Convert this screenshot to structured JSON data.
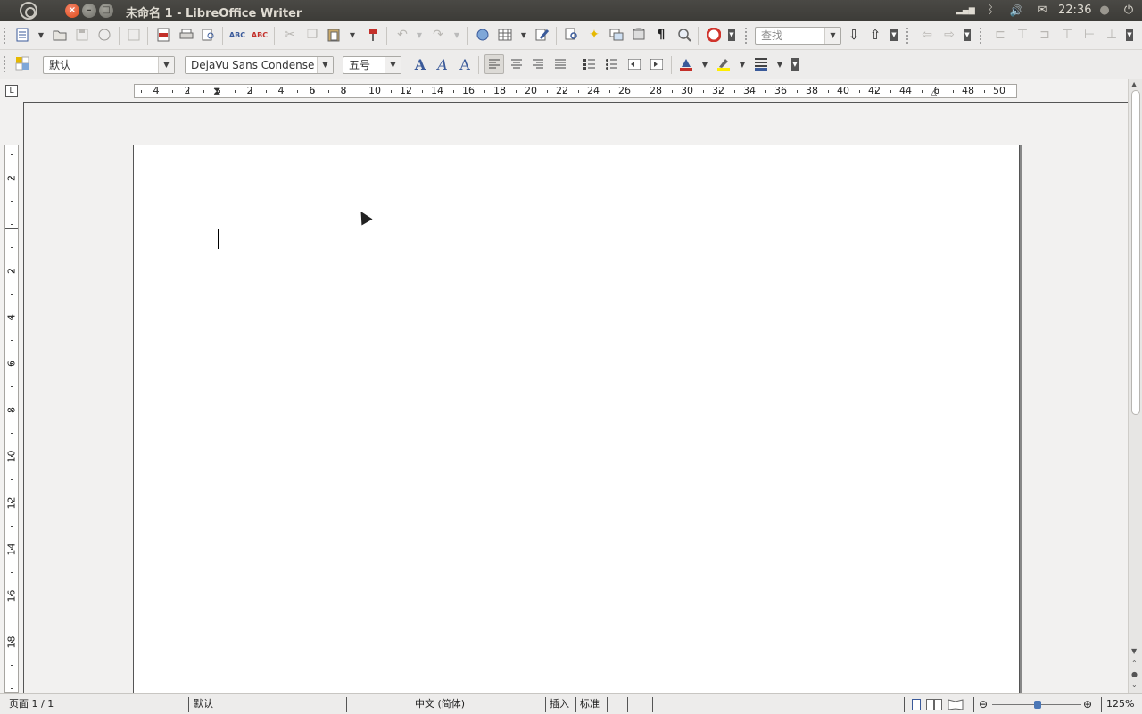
{
  "window": {
    "title": "未命名 1 - LibreOffice Writer",
    "close_label": "×",
    "min_label": "–",
    "max_label": "□"
  },
  "tray": {
    "signal_icon": "▂▄▆",
    "bluetooth_icon": "ᛒ",
    "volume_icon": "🔊",
    "mail_icon": "✉",
    "clock": "22:36",
    "chat_icon": "●",
    "power_icon": "⏻"
  },
  "standard_toolbar": {
    "search_placeholder": "查找",
    "pilcrow": "¶"
  },
  "format_toolbar": {
    "paragraph_style": "默认",
    "font_name": "DejaVu Sans Condense",
    "font_size": "五号"
  },
  "ruler": {
    "corner": "L",
    "h_ticks": [
      "4",
      "2",
      "2",
      "4",
      "6",
      "8",
      "10",
      "12",
      "14",
      "16",
      "18",
      "20",
      "22",
      "24",
      "26",
      "28",
      "30",
      "32",
      "34",
      "36",
      "38",
      "40",
      "42",
      "44",
      "6",
      "48",
      "50"
    ],
    "v_ticks": [
      "2",
      "2",
      "4",
      "6",
      "8",
      "10",
      "12",
      "14",
      "16",
      "18"
    ]
  },
  "statusbar": {
    "page": "页面 1 / 1",
    "style": "默认",
    "language": "中文 (简体)",
    "insert_mode": "插入",
    "selection_mode": "标准",
    "zoom": "125%"
  }
}
